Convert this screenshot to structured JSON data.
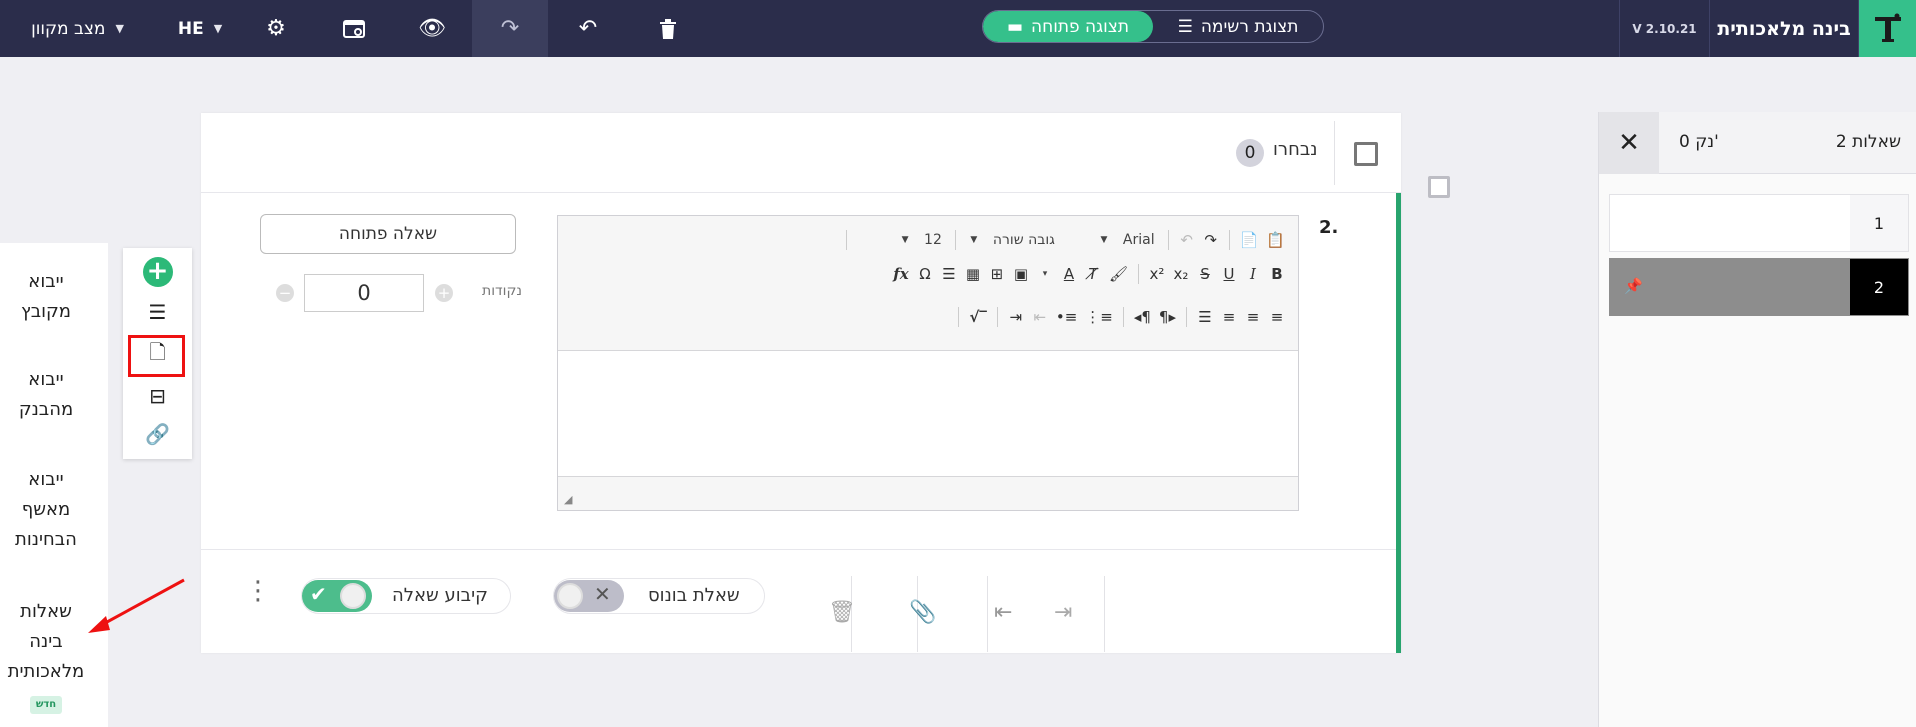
{
  "topbar": {
    "brand": "בינה מלאכותית",
    "version": "V 2.10.21",
    "view_list": "תצוגת רשימה",
    "view_open": "תצוגה פתוחה",
    "language": "HE",
    "mode": "מצב מקוון"
  },
  "question_panel": {
    "count_label": "2 שאלות",
    "points_label": "0 נק'",
    "items": [
      {
        "number": "1"
      },
      {
        "number": "2"
      }
    ]
  },
  "card": {
    "selected_label": "נבחרו",
    "selected_count": "0",
    "question_number": "2.",
    "question_type": "שאלה פתוחה",
    "points_label": "נקודות",
    "points_value": "0",
    "editor": {
      "font": "Arial",
      "line_height": "גובה שורה",
      "font_size": "12"
    },
    "footer": {
      "bonus_label": "שאלת בונוס",
      "fix_label": "קיבוע שאלה"
    }
  },
  "import_panel": {
    "items": [
      {
        "line1": "ייבוא",
        "line2": "מקובץ"
      },
      {
        "line1": "ייבוא",
        "line2": "מהבנק"
      },
      {
        "line1": "ייבוא",
        "line2": "מאשף",
        "line3": "הבחינות"
      },
      {
        "line1": "שאלות",
        "line2": "בינה",
        "line3": "מלאכותית",
        "badge": "חדש"
      }
    ]
  },
  "colors": {
    "topbar": "#2b2d4b",
    "accent_green": "#35c08b",
    "highlight_red": "#ee1111"
  }
}
